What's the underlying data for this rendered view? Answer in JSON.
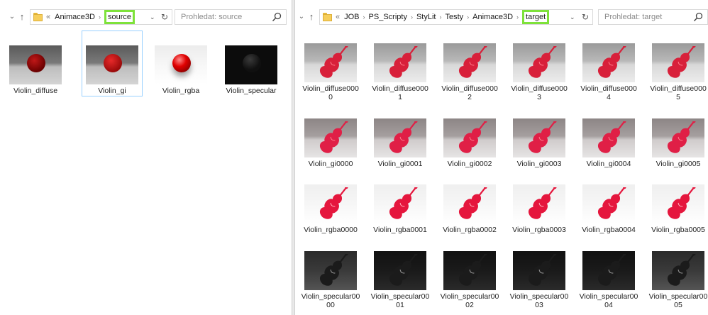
{
  "left": {
    "breadcrumb": [
      "Animace3D",
      "source"
    ],
    "overflow": "«",
    "search_placeholder": "Prohledat: source",
    "items": [
      {
        "label": "Violin_diffuse",
        "bg": "bg-grey",
        "ball": "diff"
      },
      {
        "label": "Violin_gi",
        "bg": "bg-grey",
        "ball": "gi"
      },
      {
        "label": "Violin_rgba",
        "bg": "bg-light",
        "ball": "rgba"
      },
      {
        "label": "Violin_specular",
        "bg": "bg-dark",
        "ball": "spec"
      }
    ]
  },
  "right": {
    "breadcrumb": [
      "JOB",
      "PS_Scripty",
      "StyLit",
      "Testy",
      "Animace3D",
      "target"
    ],
    "overflow": "«",
    "search_placeholder": "Prohledat: target",
    "rows": [
      {
        "type": "diffuse",
        "labels": [
          "Violin_diffuse0000",
          "Violin_diffuse0001",
          "Violin_diffuse0002",
          "Violin_diffuse0003",
          "Violin_diffuse0004",
          "Violin_diffuse0005"
        ]
      },
      {
        "type": "gi",
        "labels": [
          "Violin_gi0000",
          "Violin_gi0001",
          "Violin_gi0002",
          "Violin_gi0003",
          "Violin_gi0004",
          "Violin_gi0005"
        ]
      },
      {
        "type": "rgba",
        "labels": [
          "Violin_rgba0000",
          "Violin_rgba0001",
          "Violin_rgba0002",
          "Violin_rgba0003",
          "Violin_rgba0004",
          "Violin_rgba0005"
        ]
      },
      {
        "type": "spec",
        "labels": [
          "Violin_specular0000",
          "Violin_specular0001",
          "Violin_specular0002",
          "Violin_specular0003",
          "Violin_specular0004",
          "Violin_specular0005"
        ]
      }
    ]
  },
  "icons": {
    "back": "chevron-down-icon",
    "up": "up-arrow-icon",
    "folder": "folder-icon",
    "refresh": "refresh-icon",
    "search": "search-icon"
  },
  "colors": {
    "highlight": "#7ee23a",
    "selection": "#99d1ff",
    "violin_red": "#d8203a"
  }
}
